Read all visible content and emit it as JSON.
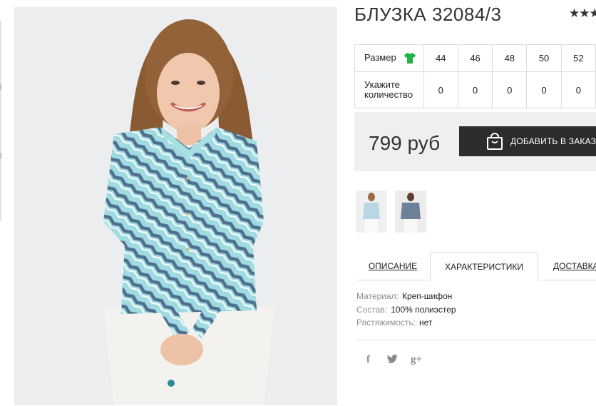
{
  "product": {
    "title": "БЛУЗКА 32084/3",
    "rating_stars": "★★★"
  },
  "size_table": {
    "size_label": "Размер",
    "qty_label_line1": "Укажите",
    "qty_label_line2": "количество",
    "sizes": [
      "44",
      "46",
      "48",
      "50",
      "52"
    ],
    "quantities": [
      "0",
      "0",
      "0",
      "0",
      "0"
    ],
    "size_icon_color": "#1fb545"
  },
  "price_bar": {
    "price": "799 руб",
    "add_button_label": "ДОБАВИТЬ В ЗАКАЗ"
  },
  "tabs": {
    "description": "ОПИСАНИЕ",
    "characteristics": "ХАРАКТЕРИСТИКИ",
    "delivery": "ДОСТАВКА И"
  },
  "specs": [
    {
      "key": "Материал:",
      "value": "Креп-шифон"
    },
    {
      "key": "Состав:",
      "value": "100% полиэстер"
    },
    {
      "key": "Растяжимость:",
      "value": "нет"
    }
  ],
  "social": {
    "facebook": "f",
    "twitter": "🐦",
    "google_plus": "g+"
  },
  "colors": {
    "blouse": "#8ccfd6",
    "button_bg": "#2c2c2c",
    "price_bar_bg": "#efefef"
  }
}
